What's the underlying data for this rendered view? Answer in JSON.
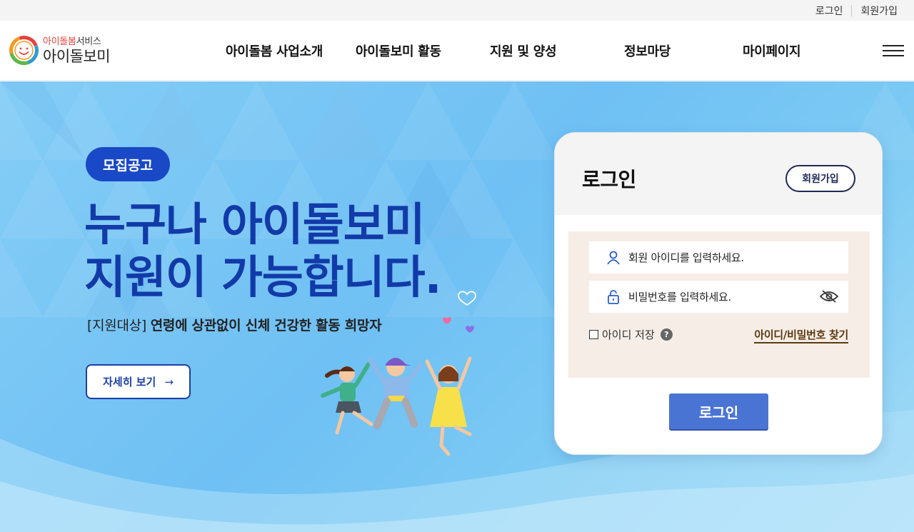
{
  "util": {
    "login": "로그인",
    "join": "회원가입"
  },
  "logo": {
    "sub_highlight": "아이돌봄",
    "sub_rest": "서비스",
    "main": "아이돌보미"
  },
  "nav": [
    {
      "label": "아이돌봄 사업소개"
    },
    {
      "label": "아이돌보미 활동"
    },
    {
      "label": "지원 및 양성"
    },
    {
      "label": "정보마당"
    },
    {
      "label": "마이페이지"
    }
  ],
  "hero": {
    "badge": "모집공고",
    "headline_1": "누구나 아이돌보미",
    "headline_2": "지원이 가능합니다.",
    "sub_prefix": "[지원대상]",
    "sub_bold": "연령에 상관없이 신체 건강한 활동 희망자",
    "detail_button": "자세히 보기",
    "detail_arrow": "→"
  },
  "login": {
    "title": "로그인",
    "join_button": "회원가입",
    "id_placeholder": "회원 아이디를 입력하세요.",
    "pw_placeholder": "비밀번호를 입력하세요.",
    "save_id": "아이디 저장",
    "help_mark": "?",
    "find_link": "아이디/비밀번호 찾기",
    "submit": "로그인"
  },
  "colors": {
    "brand_blue": "#123aa8",
    "badge_blue": "#1a49c7",
    "login_button": "#4a74d3",
    "hero_sky": "#6fc0f4"
  },
  "icons": [
    "smile-logo-icon",
    "hamburger-menu-icon",
    "user-icon",
    "lock-icon",
    "eye-off-icon",
    "help-icon",
    "heart-icon"
  ]
}
